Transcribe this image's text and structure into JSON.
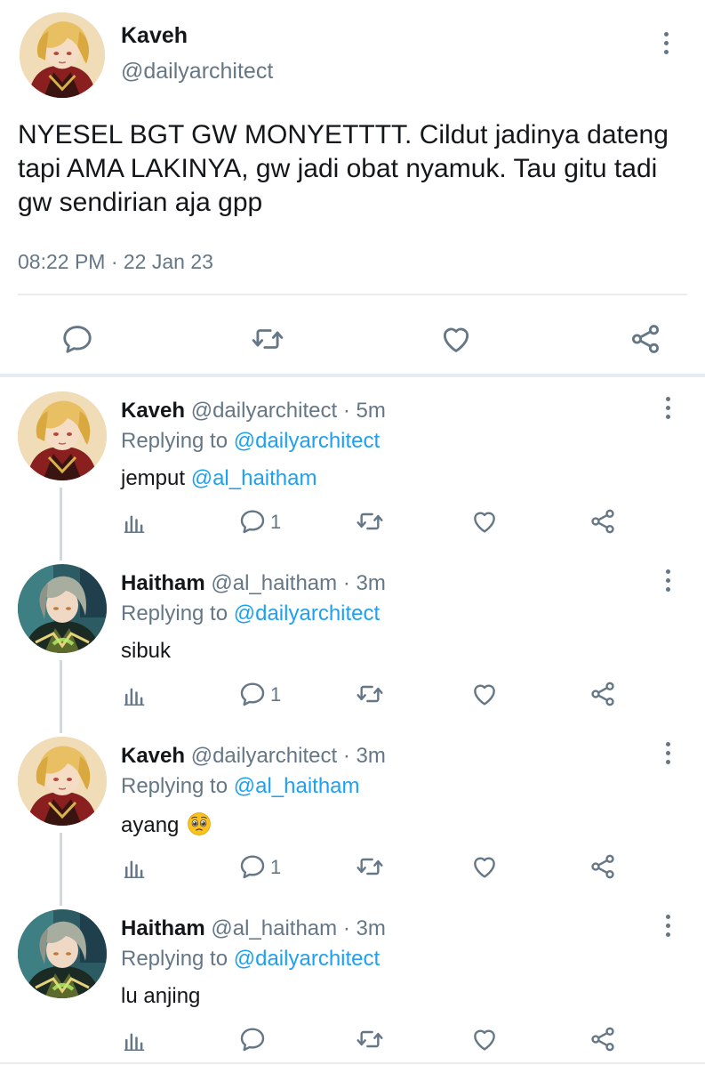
{
  "main": {
    "name": "Kaveh",
    "handle": "@dailyarchitect",
    "text": "NYESEL BGT GW MONYETTTT. Cildut jadinya dateng tapi AMA LAKINYA, gw jadi obat nyamuk. Tau gitu tadi gw sendirian aja gpp",
    "timestamp": "08:22 PM · 22 Jan 23",
    "actions": [
      "reply-icon",
      "retweet-icon",
      "like-icon",
      "share-icon"
    ]
  },
  "replies": [
    {
      "name": "Kaveh",
      "handle": "@dailyarchitect",
      "time": "· 5m",
      "replying_prefix": "Replying to",
      "replying_to": "@dailyarchitect",
      "text": "jemput ",
      "mention": "@al_haitham",
      "reply_count": "1",
      "avatar": "kaveh"
    },
    {
      "name": "Haitham",
      "handle": "@al_haitham",
      "time": "· 3m",
      "replying_prefix": "Replying to",
      "replying_to": "@dailyarchitect",
      "text": "sibuk",
      "mention": "",
      "reply_count": "1",
      "avatar": "haitham"
    },
    {
      "name": "Kaveh",
      "handle": "@dailyarchitect",
      "time": "· 3m",
      "replying_prefix": "Replying to",
      "replying_to": "@al_haitham",
      "text": "ayang ",
      "mention": "",
      "emoji": "pleading-face",
      "reply_count": "1",
      "avatar": "kaveh"
    },
    {
      "name": "Haitham",
      "handle": "@al_haitham",
      "time": "· 3m",
      "replying_prefix": "Replying to",
      "replying_to": "@dailyarchitect",
      "text": "lu anjing",
      "mention": "",
      "reply_count": "",
      "avatar": "haitham"
    }
  ],
  "colors": {
    "text": "#14171a",
    "secondary": "#657786",
    "link": "#1da1f2",
    "divider": "#e6ecf0"
  }
}
